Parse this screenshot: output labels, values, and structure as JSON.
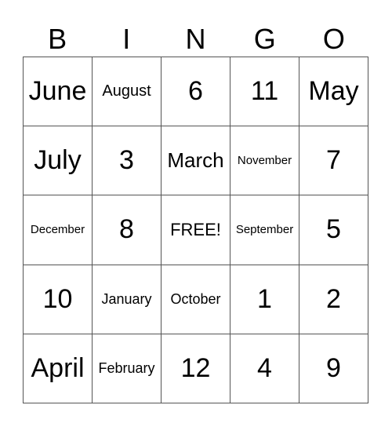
{
  "header": [
    "B",
    "I",
    "N",
    "G",
    "O"
  ],
  "rows": [
    [
      "June",
      "August",
      "6",
      "11",
      "May"
    ],
    [
      "July",
      "3",
      "March",
      "November",
      "7"
    ],
    [
      "December",
      "8",
      "FREE!",
      "September",
      "5"
    ],
    [
      "10",
      "January",
      "October",
      "1",
      "2"
    ],
    [
      "April",
      "February",
      "12",
      "4",
      "9"
    ]
  ]
}
